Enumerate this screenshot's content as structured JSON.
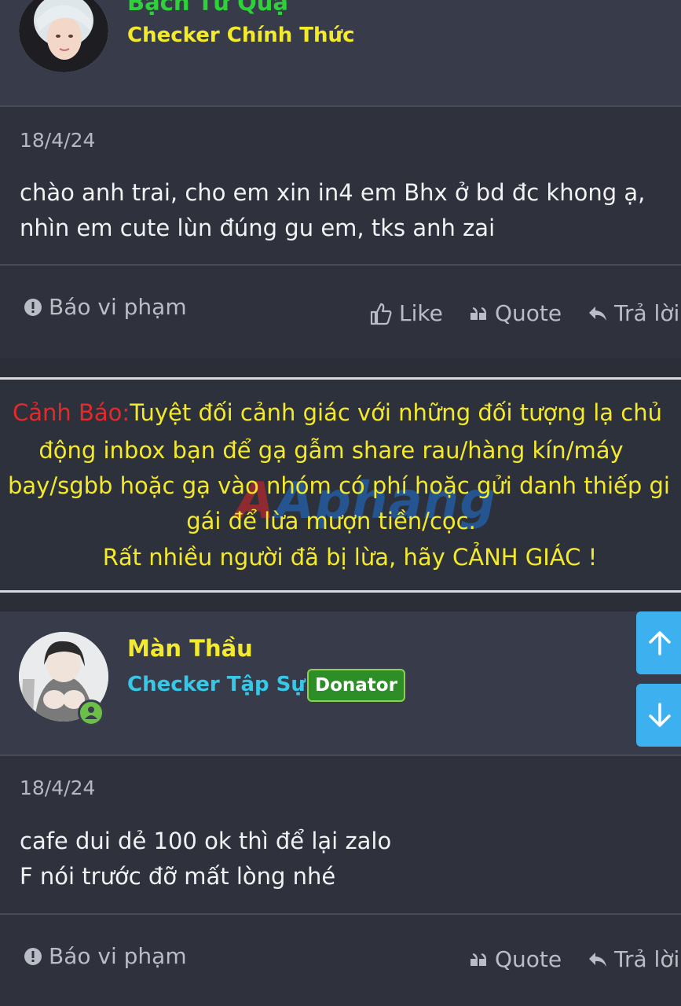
{
  "posts": [
    {
      "username": "Bạch Tử Quạ",
      "user_title": "Checker Chính Thức",
      "date": "18/4/24",
      "content_lines": [
        "chào anh trai, cho em xin in4 em Bhx ở bd đc khong ạ,",
        "nhìn em cute lùn đúng gu em, tks anh zai"
      ],
      "report_label": "Báo vi phạm",
      "like_label": "Like",
      "quote_label": "Quote",
      "reply_label": "Trả lời"
    },
    {
      "username": "Màn Thầu",
      "user_title": "Checker Tập Sự",
      "badge": "Donator",
      "date": "18/4/24",
      "content_lines": [
        "cafe dui dẻ 100 ok thì để lại zalo",
        "F nói trước đỡ mất lòng nhé"
      ],
      "report_label": "Báo vi phạm",
      "quote_label": "Quote",
      "reply_label": "Trả lời"
    }
  ],
  "warning": {
    "prefix": "Cảnh Báo:",
    "line1_rest": "Tuyệt đối cảnh giác với những đối tượng lạ chủ",
    "line2": "động inbox bạn để gạ gẫm share rau/hàng kín/máy",
    "line3": "bay/sgbb hoặc gạ vào nhóm có phí hoặc gửi danh thiếp gi",
    "line4": "gái để lừa mượn tiền/cọc.",
    "line5": "Rất nhiều người đã bị lừa, hãy CẢNH GIÁC !",
    "watermark": "Aphang"
  },
  "colors": {
    "username": "#f3ea2c",
    "title_official": "#f3ea2c",
    "title_trainee": "#37c8e8",
    "warning_text": "#f4ea2a",
    "warning_prefix": "#e42a2a",
    "scroll_button": "#3db1f0",
    "badge_bg": "#2d8d26"
  },
  "icons": [
    "exclamation-circle-icon",
    "thumbs-up-icon",
    "quote-icon",
    "reply-icon",
    "arrow-up-icon",
    "arrow-down-icon",
    "online-status-icon"
  ]
}
